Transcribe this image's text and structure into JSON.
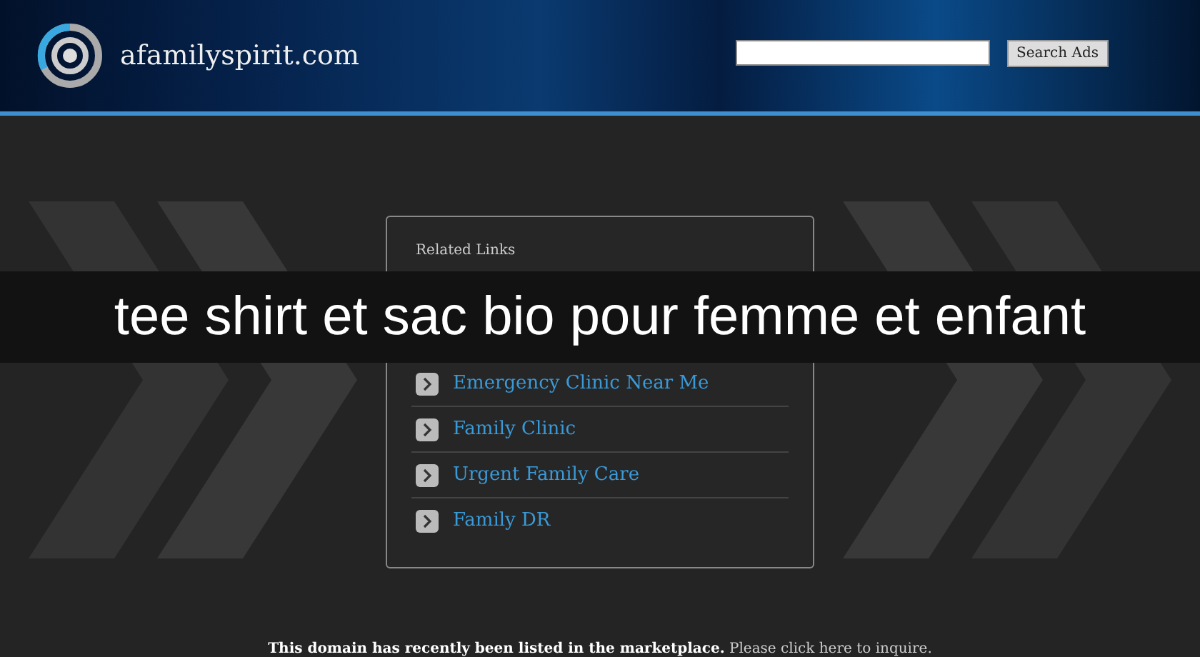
{
  "header": {
    "site_name": "afamilyspirit.com",
    "search": {
      "button": "Search Ads"
    }
  },
  "related_links": {
    "title": "Related Links",
    "items": [
      {
        "label": "Emergency Clinic Near Me"
      },
      {
        "label": "Family Clinic"
      },
      {
        "label": "Urgent Family Care"
      },
      {
        "label": "Family DR"
      }
    ]
  },
  "banner": "tee shirt et sac bio pour femme et enfant",
  "footer": "**This domain has recently been listed in the marketplace.** Please click here to inquire."
}
